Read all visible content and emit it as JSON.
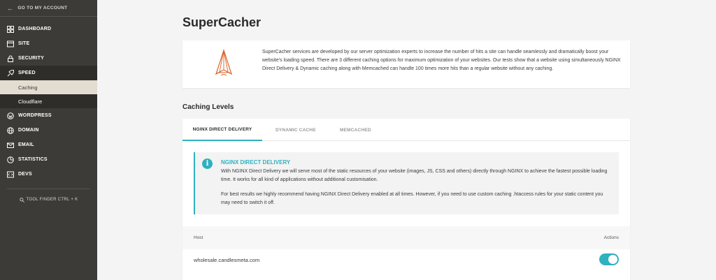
{
  "sidebar": {
    "back_label": "GO TO MY ACCOUNT",
    "items": [
      {
        "label": "DASHBOARD",
        "icon": "dashboard-icon"
      },
      {
        "label": "SITE",
        "icon": "site-icon"
      },
      {
        "label": "SECURITY",
        "icon": "lock-icon"
      },
      {
        "label": "SPEED",
        "icon": "rocket-icon",
        "active": true
      },
      {
        "label": "WORDPRESS",
        "icon": "wordpress-icon"
      },
      {
        "label": "DOMAIN",
        "icon": "globe-icon"
      },
      {
        "label": "EMAIL",
        "icon": "envelope-icon"
      },
      {
        "label": "STATISTICS",
        "icon": "pie-chart-icon"
      },
      {
        "label": "DEVS",
        "icon": "code-icon"
      }
    ],
    "subitems": [
      {
        "label": "Caching",
        "active": true
      },
      {
        "label": "Cloudflare",
        "active": false
      }
    ],
    "tool_finder": "TOOL FINDER CTRL + K"
  },
  "page": {
    "title": "SuperCacher",
    "intro": "SuperCacher services are developed by our server optimization experts to increase the number of hits a site can handle seamlessly and dramatically boost your website's loading speed. There are 3 different caching options for maximum optimization of your websites. Our tests show that a website using simultaneously NGINX Direct Delivery & Dynamic caching along with Memcached can handle 100 times more hits than a regular website without any caching.",
    "section_title": "Caching Levels"
  },
  "tabs": [
    {
      "label": "NGINX DIRECT DELIVERY",
      "active": true
    },
    {
      "label": "DYNAMIC CACHE",
      "active": false
    },
    {
      "label": "MEMCACHED",
      "active": false
    }
  ],
  "notice": {
    "icon": "info-icon",
    "title": "NGINX DIRECT DELIVERY",
    "p1": "With NGINX Direct Delivery we will serve most of the static resources of your website (images, JS, CSS and others) directly through NGINX to achieve the fastest possible loading time. It works for all kind of applications without additional customisation.",
    "p2": "For best results we highly recommend having NGINX Direct Delivery enabled at all times. However, if you need to use custom caching .htaccess rules for your static content you may need to switch it off."
  },
  "table": {
    "col_host": "Host",
    "col_actions": "Actions",
    "rows": [
      {
        "host": "wholesale.candlesmeta.com",
        "enabled": true
      }
    ]
  },
  "colors": {
    "accent": "#2fb1bf",
    "sidebar_bg": "#3d3b37",
    "sidebar_active": "#2f2d2a",
    "subitem_active_bg": "#e3dcd0",
    "logo": "#d9622b"
  }
}
